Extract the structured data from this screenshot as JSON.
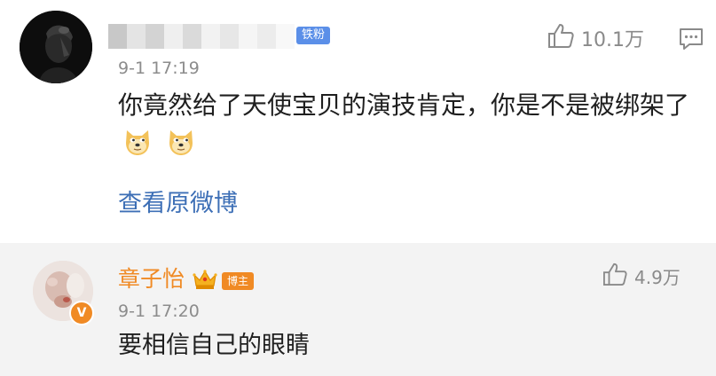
{
  "comment": {
    "badge_label": "铁粉",
    "timestamp": "9-1 17:19",
    "text": "你竟然给了天使宝贝的演技肯定，你是不是被绑架了",
    "emoji_icons": [
      "doge-emoji",
      "doge-emoji"
    ],
    "like_count": "10.1万",
    "view_original_link": "查看原微博"
  },
  "reply": {
    "username": "章子怡",
    "badge_label": "博主",
    "verified_badge": "V",
    "timestamp": "9-1 17:20",
    "text": "要相信自己的眼睛",
    "like_count": "4.9万"
  },
  "colors": {
    "accent_orange": "#f08a24",
    "link_blue": "#3d6fb6",
    "fan_badge_blue": "#5b8fe8",
    "reply_background": "#f3f3f3"
  }
}
